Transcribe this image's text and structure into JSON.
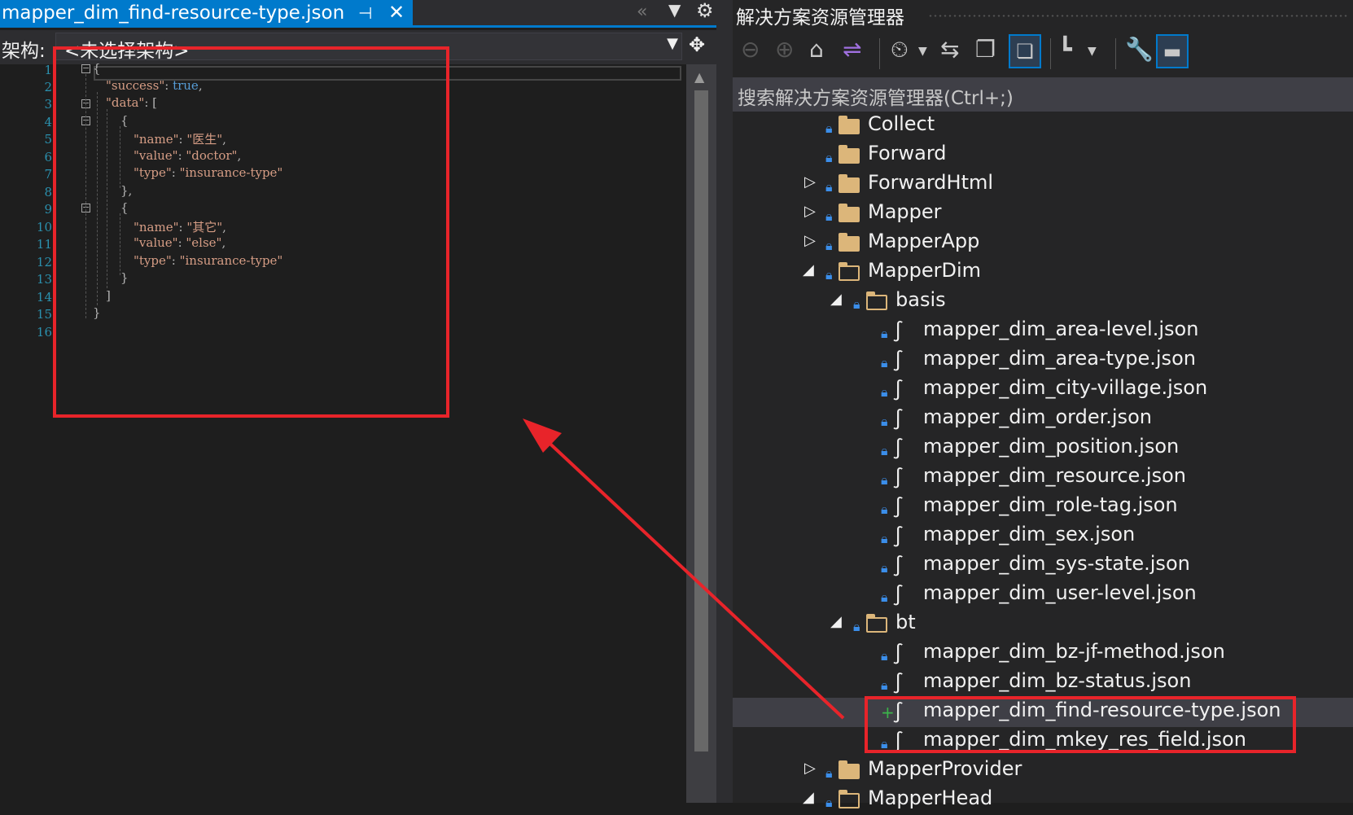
{
  "editor": {
    "tab": {
      "title": "mapper_dim_find-resource-type.json",
      "pin_icon": "pin-icon",
      "close_icon": "close-icon"
    },
    "schema": {
      "label": "架构:",
      "value": "<未选择架构>"
    },
    "line_numbers": [
      "1",
      "2",
      "3",
      "4",
      "5",
      "6",
      "7",
      "8",
      "9",
      "10",
      "11",
      "12",
      "13",
      "14",
      "15",
      "16"
    ],
    "code": {
      "l1": "{",
      "l2_key": "\"success\"",
      "l2_rest": ": ",
      "l2_val": "true",
      "l2_end": ",",
      "l3_key": "\"data\"",
      "l3_rest": ": [",
      "l4": "{",
      "l5_key": "\"name\"",
      "l5_rest": ": ",
      "l5_val": "\"医生\"",
      "l5_end": ",",
      "l6_key": "\"value\"",
      "l6_rest": ": ",
      "l6_val": "\"doctor\"",
      "l6_end": ",",
      "l7_key": "\"type\"",
      "l7_rest": ": ",
      "l7_val": "\"insurance-type\"",
      "l8": "},",
      "l9": "{",
      "l10_key": "\"name\"",
      "l10_rest": ": ",
      "l10_val": "\"其它\"",
      "l10_end": ",",
      "l11_key": "\"value\"",
      "l11_rest": ": ",
      "l11_val": "\"else\"",
      "l11_end": ",",
      "l12_key": "\"type\"",
      "l12_rest": ": ",
      "l12_val": "\"insurance-type\"",
      "l13": "}",
      "l14": "]",
      "l15": "}"
    }
  },
  "solution_explorer": {
    "title": "解决方案资源管理器",
    "search_placeholder": "搜索解决方案资源管理器(Ctrl+;)",
    "tree": [
      {
        "label": "Collect"
      },
      {
        "label": "Forward"
      },
      {
        "label": "ForwardHtml"
      },
      {
        "label": "Mapper"
      },
      {
        "label": "MapperApp"
      },
      {
        "label": "MapperDim"
      },
      {
        "label": "basis"
      },
      {
        "label": "mapper_dim_area-level.json"
      },
      {
        "label": "mapper_dim_area-type.json"
      },
      {
        "label": "mapper_dim_city-village.json"
      },
      {
        "label": "mapper_dim_order.json"
      },
      {
        "label": "mapper_dim_position.json"
      },
      {
        "label": "mapper_dim_resource.json"
      },
      {
        "label": "mapper_dim_role-tag.json"
      },
      {
        "label": "mapper_dim_sex.json"
      },
      {
        "label": "mapper_dim_sys-state.json"
      },
      {
        "label": "mapper_dim_user-level.json"
      },
      {
        "label": "bt"
      },
      {
        "label": "mapper_dim_bz-jf-method.json"
      },
      {
        "label": "mapper_dim_bz-status.json"
      },
      {
        "label": "mapper_dim_find-resource-type.json"
      },
      {
        "label": "mapper_dim_mkey_res_field.json"
      },
      {
        "label": "MapperProvider"
      },
      {
        "label": "MapperHead"
      }
    ]
  },
  "colors": {
    "accent": "#007acc",
    "annotation_red": "#e8242a",
    "folder": "#dcb67a"
  }
}
